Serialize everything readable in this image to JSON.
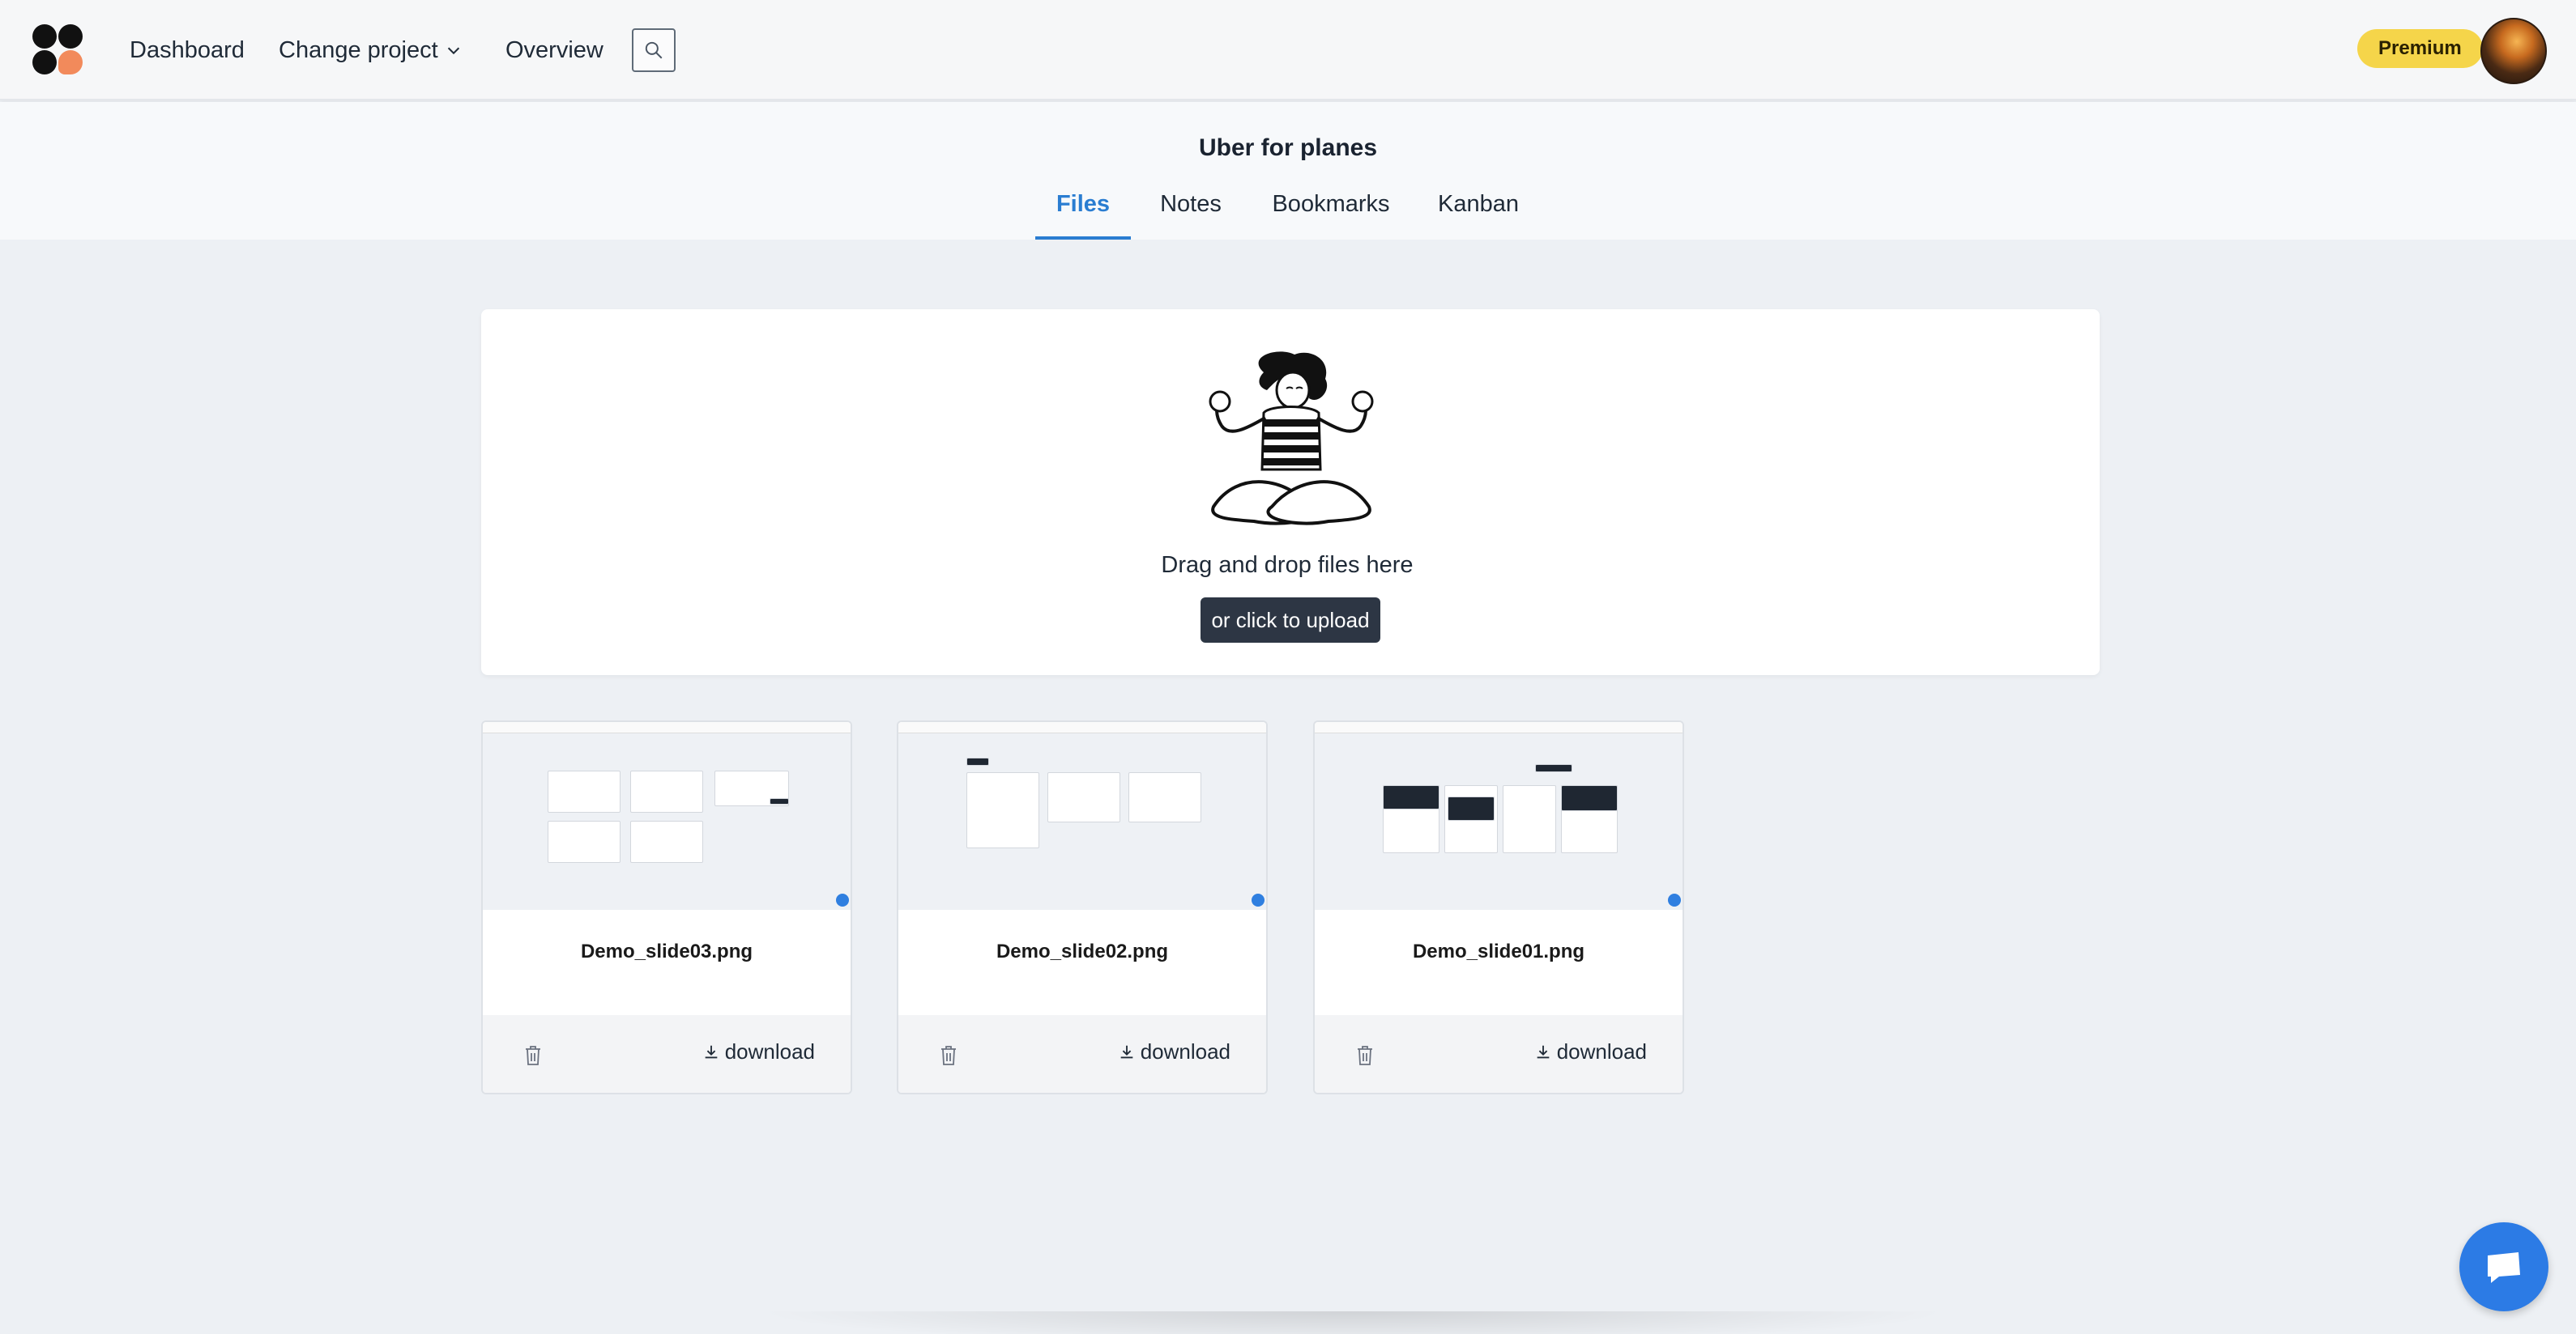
{
  "nav": {
    "dashboard": "Dashboard",
    "change_project": "Change project",
    "overview": "Overview",
    "premium": "Premium"
  },
  "project": {
    "title": "Uber for planes",
    "tabs": [
      {
        "label": "Files",
        "active": true
      },
      {
        "label": "Notes",
        "active": false
      },
      {
        "label": "Bookmarks",
        "active": false
      },
      {
        "label": "Kanban",
        "active": false
      }
    ]
  },
  "dropzone": {
    "text": "Drag and drop files here",
    "button": "or click to upload"
  },
  "files": [
    {
      "name": "Demo_slide03.png",
      "download": "download"
    },
    {
      "name": "Demo_slide02.png",
      "download": "download"
    },
    {
      "name": "Demo_slide01.png",
      "download": "download"
    }
  ],
  "icons": {
    "search": "search-icon",
    "chevron": "chevron-down-icon",
    "trash": "trash-icon",
    "download": "download-icon",
    "chat": "chat-icon"
  },
  "colors": {
    "accent": "#2a7dd1",
    "premium": "#f5d54a",
    "upload_button": "#2d3644",
    "chat": "#2c7be5"
  }
}
